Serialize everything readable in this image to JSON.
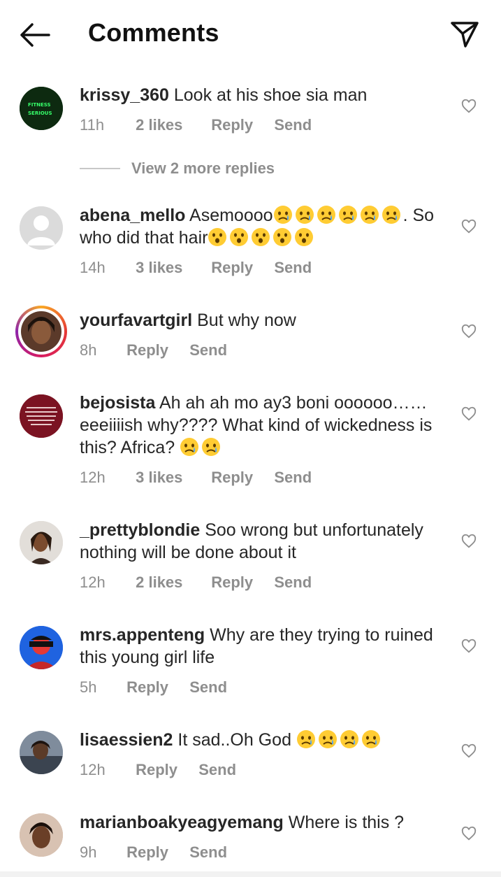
{
  "header": {
    "title": "Comments"
  },
  "view_more": "View 2 more replies",
  "comments": [
    {
      "username": "krissy_360",
      "text": "Look at his shoe sia man",
      "time": "11h",
      "likes": "2 likes",
      "reply": "Reply",
      "send": "Send",
      "avatar_text": [
        "FITNESS",
        "SERIOUS"
      ]
    },
    {
      "username": "abena_mello",
      "text": "Asemoooo",
      "text_mid": ". So who did that hair",
      "time": "14h",
      "likes": "3 likes",
      "reply": "Reply",
      "send": "Send"
    },
    {
      "username": "yourfavartgirl",
      "text": "But why now",
      "time": "8h",
      "reply": "Reply",
      "send": "Send"
    },
    {
      "username": "bejosista",
      "text": "Ah ah ah mo ay3 boni oooooo…… eeeiiiish why???? What kind of wickedness is this? Africa?",
      "time": "12h",
      "likes": "3 likes",
      "reply": "Reply",
      "send": "Send"
    },
    {
      "username": "_prettyblondie",
      "text": "Soo wrong but unfortunately nothing will be done about it",
      "time": "12h",
      "likes": "2 likes",
      "reply": "Reply",
      "send": "Send"
    },
    {
      "username": "mrs.appenteng",
      "text": "Why are they trying to ruined this young girl life",
      "time": "5h",
      "reply": "Reply",
      "send": "Send"
    },
    {
      "username": "lisaessien2",
      "text": "It sad..Oh God",
      "time": "12h",
      "reply": "Reply",
      "send": "Send"
    },
    {
      "username": "marianboakyeagyemang",
      "text": "Where is this ?",
      "time": "9h",
      "reply": "Reply",
      "send": "Send"
    }
  ],
  "colors": {
    "meta_gray": "#8e8e8e",
    "text": "#262626",
    "story_ring": "#d81b60"
  },
  "icons": {
    "back": "arrow-left-icon",
    "share": "paper-plane-icon",
    "like": "heart-outline-icon"
  }
}
